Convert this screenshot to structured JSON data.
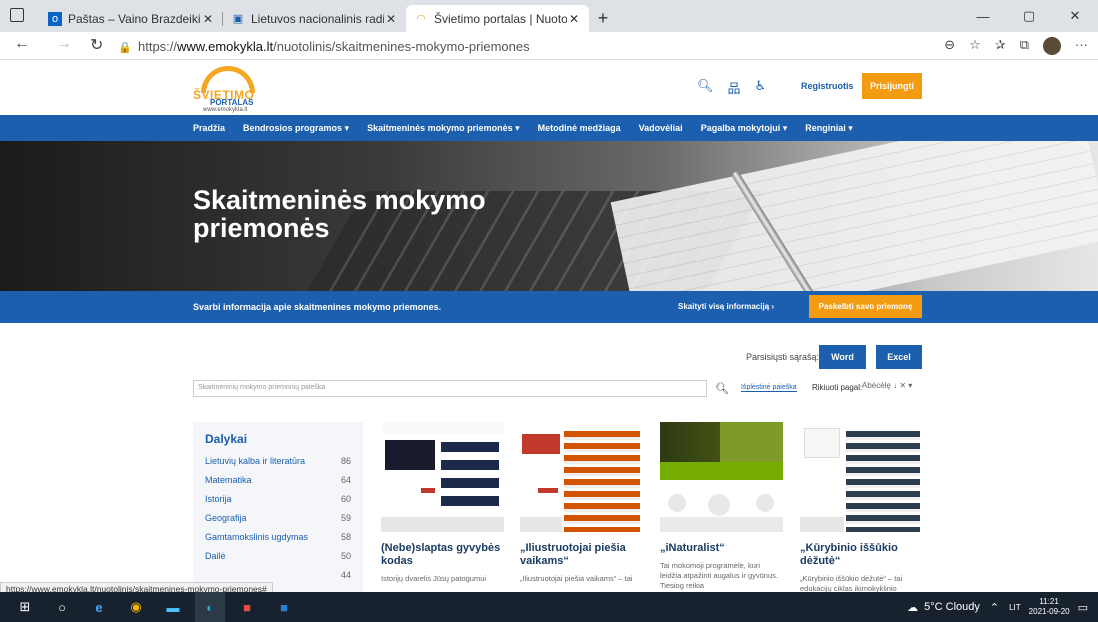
{
  "browser": {
    "tabs": [
      {
        "label": "Paštas – Vaino Brazdeikis – „Outl",
        "icon": "outlook-icon"
      },
      {
        "label": "Lietuvos nacionalinis radijas ir tel",
        "icon": "lrt-icon"
      },
      {
        "label": "Švietimo portalas | Nuotolinis mo",
        "icon": "portal-icon",
        "active": true
      }
    ],
    "url_prefix": "https://",
    "url_domain": "www.emokykla.lt",
    "url_path": "/nuotolinis/skaitmenines-mokymo-priemones"
  },
  "header": {
    "logo_l1": "ŠVIETIMO",
    "logo_l2": "PORTALAS",
    "logo_l3": "www.emokykla.lt",
    "register": "Registruotis",
    "login": "Prisijungti"
  },
  "menu": [
    "Pradžia",
    "Bendrosios programos ▾",
    "Skaitmeninės mokymo priemonės ▾",
    "Metodinė medžiaga",
    "Vadovėliai",
    "Pagalba mokytojui ▾",
    "Renginiai ▾"
  ],
  "hero": {
    "title": "Skaitmeninės mokymo priemonės"
  },
  "infobar": {
    "text": "Svarbi informacija apie skaitmenines mokymo priemones.",
    "more": "Skaityti visą informaciją  ›",
    "button": "Paskelbti savo priemonę"
  },
  "download": {
    "label": "Parsisiųsti sąrašą:",
    "word": "Word",
    "excel": "Excel"
  },
  "search": {
    "placeholder": "Skaitmeninių mokymo priemonių paieška",
    "advanced": "Išplėstinė paieška",
    "sort_label": "Rikiuoti pagal:",
    "sort_value": "Abėcėlę ↓  ✕  ▾"
  },
  "sidebar": {
    "title": "Dalykai",
    "items": [
      {
        "name": "Lietuvių kalba ir literatūra",
        "count": "86"
      },
      {
        "name": "Matematika",
        "count": "64"
      },
      {
        "name": "Istorija",
        "count": "60"
      },
      {
        "name": "Geografija",
        "count": "59"
      },
      {
        "name": "Gamtamokslinis ugdymas",
        "count": "58"
      },
      {
        "name": "Dailė",
        "count": "50"
      },
      {
        "name": "",
        "count": "44"
      }
    ]
  },
  "cards": [
    {
      "title": "(Nebe)slaptas gyvybės kodas",
      "desc": "Istorijų dvarelis Jūsų patogumui"
    },
    {
      "title": "„Iliustruotojai piešia vaikams“",
      "desc": "„Iliustruotojai piešia vaikams“ – tai"
    },
    {
      "title": "„iNaturalist“",
      "desc": "Tai mokomoji programėlė, kuri leidžia atpažinti augalus ir gyvūnus. Tiesiog reikia"
    },
    {
      "title": "„Kūrybinio iššūkio dėžutė“",
      "desc": "„Kūrybinio iššūkio dėžutė“ – tai edukacijų ciklas ikimokyklinio amžiaus, pradinių mokyklų mokinių"
    }
  ],
  "status_url": "https://www.emokykla.lt/nuotolinis/skaitmenines-mokymo-priemones#",
  "taskbar": {
    "weather": "5°C  Cloudy",
    "lang": "LIT",
    "time": "11:21",
    "date": "2021-09-20"
  }
}
